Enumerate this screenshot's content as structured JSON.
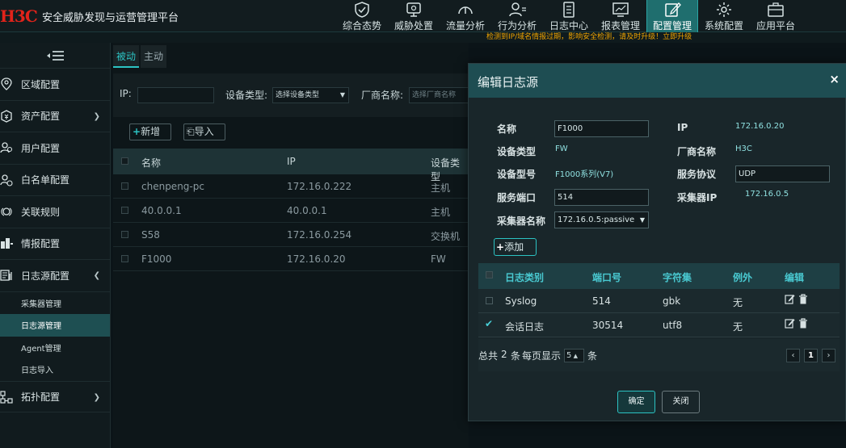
{
  "header": {
    "logo": "H3C",
    "title": "安全威胁发现与运营管理平台",
    "nav": [
      {
        "label": "综合态势",
        "icon": "shield-check-icon"
      },
      {
        "label": "威胁处置",
        "icon": "monitor-icon"
      },
      {
        "label": "流量分析",
        "icon": "gauge-icon"
      },
      {
        "label": "行为分析",
        "icon": "user-list-icon"
      },
      {
        "label": "日志中心",
        "icon": "document-icon"
      },
      {
        "label": "报表管理",
        "icon": "chart-board-icon"
      },
      {
        "label": "配置管理",
        "icon": "edit-config-icon",
        "active": true
      },
      {
        "label": "系统配置",
        "icon": "gear-icon"
      },
      {
        "label": "应用平台",
        "icon": "toolbox-icon"
      }
    ],
    "notice": "检测到IP/域名情报过期，影响安全检测，请及时升级！立即升级"
  },
  "sidebar": {
    "items": [
      {
        "label": "区域配置",
        "icon": "location-icon"
      },
      {
        "label": "资产配置",
        "icon": "asset-icon"
      },
      {
        "label": "用户配置",
        "icon": "users-icon"
      },
      {
        "label": "白名单配置",
        "icon": "whitelist-icon"
      },
      {
        "label": "关联规则",
        "icon": "rules-icon"
      },
      {
        "label": "情报配置",
        "icon": "intel-icon"
      },
      {
        "label": "日志源配置",
        "icon": "log-source-icon"
      },
      {
        "label": "拓扑配置",
        "icon": "topology-icon"
      }
    ],
    "sub_items": [
      "采集器管理",
      "日志源管理",
      "Agent管理",
      "日志导入"
    ]
  },
  "main": {
    "tabs": [
      "被动",
      "主动"
    ],
    "filter": {
      "ip_label": "IP:",
      "ip_value": "",
      "type_label": "设备类型:",
      "type_placeholder": "选择设备类型",
      "vendor_label": "厂商名称:",
      "vendor_placeholder": "选择厂商名称"
    },
    "add_label": "新增",
    "import_label": "导入",
    "columns": [
      "名称",
      "IP",
      "设备类型"
    ],
    "rows": [
      {
        "name": "chenpeng-pc",
        "ip": "172.16.0.222",
        "type": "主机"
      },
      {
        "name": "40.0.0.1",
        "ip": "40.0.0.1",
        "type": "主机"
      },
      {
        "name": "S58",
        "ip": "172.16.0.254",
        "type": "交换机"
      },
      {
        "name": "F1000",
        "ip": "172.16.0.20",
        "type": "FW"
      }
    ]
  },
  "dialog": {
    "title": "编辑日志源",
    "close": "×",
    "fields": {
      "name_label": "名称",
      "name_value": "F1000",
      "ip_label": "IP",
      "ip_value": "172.16.0.20",
      "devtype_label": "设备类型",
      "devtype_value": "FW",
      "vendor_label": "厂商名称",
      "vendor_value": "H3C",
      "model_label": "设备型号",
      "model_value": "F1000系列(V7)",
      "protocol_label": "服务协议",
      "protocol_value": "UDP",
      "port_label": "服务端口",
      "port_value": "514",
      "collector_ip_label": "采集器IP",
      "collector_ip_value": "172.16.0.5",
      "collector_name_label": "采集器名称",
      "collector_name_value": "172.16.0.5:passive"
    },
    "add_label": "添加",
    "columns": [
      "日志类别",
      "端口号",
      "字符集",
      "例外",
      "编辑"
    ],
    "rows": [
      {
        "category": "Syslog",
        "port": "514",
        "charset": "gbk",
        "exception": "无",
        "checked": false
      },
      {
        "category": "会话日志",
        "port": "30514",
        "charset": "utf8",
        "exception": "无",
        "checked": true
      }
    ],
    "pager": {
      "total_prefix": "总共",
      "total": "2",
      "total_suffix": "条",
      "per_page_label": "每页显示",
      "per_page": "5",
      "unit": "条",
      "current_page": "1",
      "prev": "‹",
      "next": "›"
    },
    "confirm_label": "确定",
    "close_label": "关闭"
  },
  "colors": {
    "accent": "#2cc3c3",
    "header_bg": "#121c1f",
    "active_nav": "#1f6e6e",
    "warning": "#f0a400",
    "brand_red": "#e2231a"
  }
}
